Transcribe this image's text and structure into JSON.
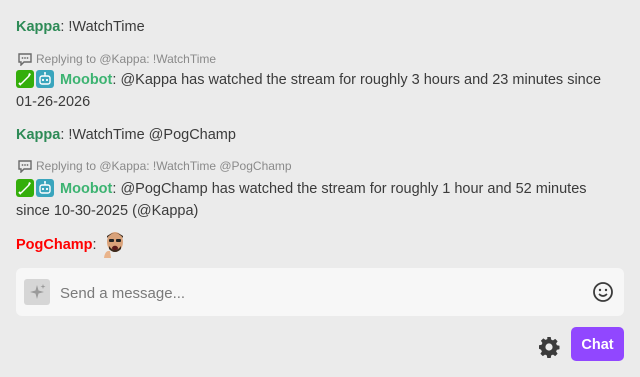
{
  "colors": {
    "kappa": "#2e8b57",
    "moobot": "#3cb371",
    "pogchamp": "#ff0000",
    "accent": "#9147ff"
  },
  "messages": [
    {
      "user": "Kappa",
      "text": "!WatchTime"
    },
    {
      "reply": "Replying to @Kappa: !WatchTime",
      "user": "Moobot",
      "badges": [
        "moderator-badge-icon",
        "bot-badge-icon"
      ],
      "text": "@Kappa has watched the stream for roughly 3 hours and 23 minutes since 01-26-2026"
    },
    {
      "user": "Kappa",
      "text": "!WatchTime @PogChamp"
    },
    {
      "reply": "Replying to @Kappa: !WatchTime @PogChamp",
      "user": "Moobot",
      "badges": [
        "moderator-badge-icon",
        "bot-badge-icon"
      ],
      "text": "@PogChamp has watched the stream for roughly 1 hour and 52 minutes since 10-30-2025 (@Kappa)"
    },
    {
      "user": "PogChamp",
      "emote": "pogchamp-emote"
    }
  ],
  "input": {
    "placeholder": "Send a message...",
    "value": ""
  },
  "colon": ":",
  "chat_button": "Chat"
}
